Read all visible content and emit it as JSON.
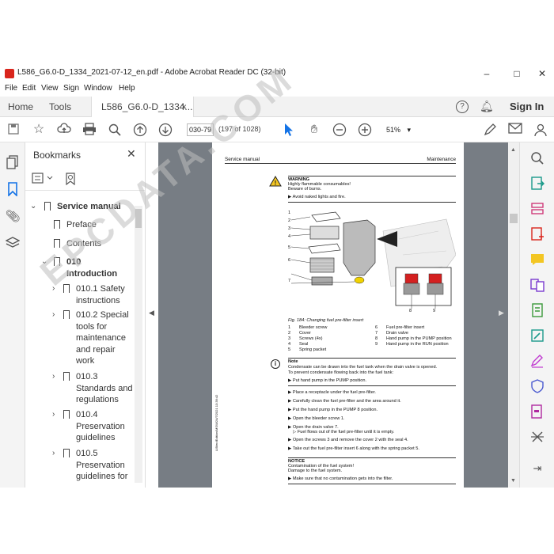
{
  "window": {
    "title": "L586_G6.0-D_1334_2021-07-12_en.pdf - Adobe Acrobat Reader DC (32-bit)",
    "minimize": "–",
    "maximize": "□",
    "close": "✕"
  },
  "menu": [
    "File",
    "Edit",
    "View",
    "Sign",
    "Window",
    "Help"
  ],
  "tabs": {
    "home": "Home",
    "tools": "Tools",
    "doc": "L586_G6.0-D_1334...",
    "doc_close": "×",
    "sign_in": "Sign In"
  },
  "toolbar": {
    "page_value": "030-79",
    "page_count": "(197 of 1028)",
    "zoom": "51%",
    "zoom_caret": "▾"
  },
  "bookmarks": {
    "title": "Bookmarks",
    "close": "✕",
    "items": [
      {
        "label": "Service manual"
      },
      {
        "label": "Preface"
      },
      {
        "label": "Contents"
      },
      {
        "label": "010\nIntroduction"
      },
      {
        "label": "010.1 Safety\ninstructions"
      },
      {
        "label": "010.2 Special\ntools for\nmaintenance\nand repair\nwork"
      },
      {
        "label": "010.3\nStandards and\nregulations"
      },
      {
        "label": "010.4\nPreservation\nguidelines"
      },
      {
        "label": "010.5\nPreservation\nguidelines for"
      }
    ]
  },
  "page": {
    "header_left": "Service manual",
    "header_right": "Maintenance",
    "warning_title": "WARNING",
    "warning_l1": "Highly flammable consumables!",
    "warning_l2": "Beware of burns.",
    "warning_bullet": "Avoid naked lights and fire.",
    "fig_caption": "Fig. 184: Changing fuel pre-filter insert",
    "legend": [
      [
        "1",
        "Bleeder screw",
        "6",
        "Fuel pre-filter insert"
      ],
      [
        "2",
        "Cover",
        "7",
        "Drain valve"
      ],
      [
        "3",
        "Screws (4x)",
        "8",
        "Hand pump in the PUMP position"
      ],
      [
        "4",
        "Seal",
        "9",
        "Hand pump in the RUN position"
      ],
      [
        "5",
        "Spring packet",
        "",
        ""
      ]
    ],
    "note_title": "Note",
    "note_l1": "Condensate can be drawn into the fuel tank when the drain valve is opened.",
    "note_l2": "To prevent condensate flowing back into the fuel tank:",
    "note_bullet": "Put hand pump in the PUMP position.",
    "steps": [
      "Place a receptacle under the fuel pre-filter.",
      "Carefully clean the fuel pre-filter and the area around it.",
      "Put the hand pump in the PUMP 8 position.",
      "Open the bleeder screw 1.",
      "Open the drain valve 7.",
      "Fuel flows out of the fuel pre-filter until it is empty.",
      "Open the screws 3 and remove the cover 2 with the seal 4.",
      "Take out the fuel pre-filter insert 6 along with the spring packet 5."
    ],
    "notice_title": "NOTICE",
    "notice_l1": "Contamination of the fuel system!",
    "notice_l2": "Damage to the fuel system.",
    "notice_bullet": "Make sure that no contamination gets into the filter.",
    "side_code": "LIB/en/Edition/MSW/24/7/2021 13:39:42",
    "callouts": [
      "1",
      "2",
      "3",
      "4",
      "5",
      "6",
      "7",
      "8",
      "9"
    ]
  },
  "watermark": "EPCDATA.COM",
  "colors": {
    "acrobat_red": "#d9251c",
    "accent_blue": "#1473e6",
    "doc_bg": "#777d84"
  }
}
